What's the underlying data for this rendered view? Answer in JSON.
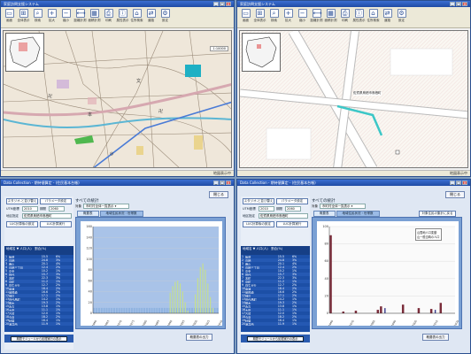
{
  "win1": {
    "title": "家庭訪問支援システム",
    "toolbar": [
      "画面",
      "全体表示",
      "検索",
      "拡大",
      "縮小",
      "距離計測",
      "面積計測",
      "印刷",
      "属性表示",
      "住所検索",
      "道路",
      "設定"
    ],
    "status": "地図表示中"
  },
  "win2": {
    "title": "家庭訪問支援システム",
    "toolbar": [
      "画面",
      "全体表示",
      "検索",
      "拡大",
      "縮小",
      "距離計測",
      "面積計測",
      "印刷",
      "属性表示",
      "住所検索",
      "道路",
      "設定"
    ],
    "map_label": "佐賀県鳥栖市鳥栖町",
    "status": "地図表示中"
  },
  "win3": {
    "title": "Data Collection - 期待値算定 - (住民基本台帳)",
    "close_label": "閉じる",
    "header": "すべての統計",
    "buttons": [
      "スタジオ-と並び替え",
      "パラメータ設定",
      "LUC計算後の設定",
      "LUC計算実行"
    ],
    "labels": [
      "UTM座標",
      "期間",
      "地区指定"
    ],
    "inputs": [
      "2010",
      "2060",
      "佐賀県鳥栖市鳥栖町"
    ],
    "select_label": "対象",
    "select_value": "市町村全体一覧表示",
    "tabs": [
      "概要表",
      "地域住民状況・世帯数"
    ],
    "list_header": "地域名 ▼ 人口(人)　割合(%)",
    "list": [
      [
        "1",
        "飯盛",
        "15.5",
        "6%"
      ],
      [
        "2",
        "鳥栖",
        "24.8",
        "3%"
      ],
      [
        "3",
        "鹿山",
        "20.1",
        "4%"
      ],
      [
        "4",
        "鳥栖三丁目",
        "12.4",
        "2%"
      ],
      [
        "5",
        "中央",
        "10.2",
        "1%"
      ],
      [
        "6",
        "田代",
        "15.7",
        "3%"
      ],
      [
        "7",
        "本町",
        "22.3",
        "3%"
      ],
      [
        "8",
        "京町",
        "11.2",
        "1%"
      ],
      [
        "9",
        "弥生が丘",
        "12.7",
        "2%"
      ],
      [
        "10",
        "幸津",
        "18.4",
        "2%"
      ],
      [
        "11",
        "曽根崎",
        "16.6",
        "2%"
      ],
      [
        "12",
        "神辺",
        "17.1",
        "2%"
      ],
      [
        "13",
        "田代昌町",
        "14.2",
        "1%"
      ],
      [
        "14",
        "藤木",
        "19.3",
        "2%"
      ],
      [
        "15",
        "永吉",
        "13.8",
        "1%"
      ],
      [
        "16",
        "大田",
        "11.1",
        "1%"
      ],
      [
        "17",
        "古賀",
        "12.0",
        "1%"
      ],
      [
        "18",
        "今泉",
        "18.2",
        "2%"
      ],
      [
        "19",
        "秋葉",
        "16.4",
        "1%"
      ],
      [
        "20",
        "酒井西",
        "11.9",
        "1%"
      ]
    ],
    "footer_button": "期間モジュールから処理実行の表示",
    "action_button": "概要表の出力",
    "chart_data": {
      "type": "bar",
      "title": "",
      "xlabel": "",
      "ylabel": "",
      "ylim": [
        0,
        160
      ],
      "yticks": [
        0,
        20,
        40,
        60,
        80,
        100,
        120,
        140,
        160
      ],
      "categories": [
        "1",
        "2",
        "3",
        "4",
        "5",
        "6",
        "7",
        "8",
        "9",
        "10",
        "11",
        "12",
        "13",
        "14",
        "15",
        "16",
        "17",
        "18",
        "19",
        "20",
        "21",
        "22",
        "23",
        "24",
        "25",
        "26",
        "27",
        "28",
        "29",
        "30",
        "31",
        "32",
        "33",
        "34",
        "35",
        "36",
        "37",
        "38",
        "39",
        "40",
        "41",
        "42",
        "43",
        "44",
        "45",
        "46",
        "47",
        "48",
        "49",
        "50"
      ],
      "xticklabels": [
        "1960",
        "1965",
        "1970",
        "1975",
        "1980",
        "1985",
        "1990",
        "1995",
        "2000",
        "2005",
        "2010"
      ],
      "series": [
        {
          "values": [
            10,
            10,
            10,
            10,
            10,
            10,
            10,
            10,
            10,
            10,
            10,
            10,
            10,
            10,
            10,
            10,
            10,
            10,
            10,
            10,
            10,
            10,
            10,
            10,
            10,
            10,
            10,
            10,
            10,
            10,
            10,
            10,
            10,
            10,
            10,
            10,
            10,
            10,
            10,
            10,
            10,
            10,
            10,
            10,
            10,
            10,
            10,
            10,
            10,
            10
          ]
        },
        {
          "values": [
            0,
            0,
            0,
            0,
            0,
            0,
            0,
            0,
            0,
            0,
            0,
            0,
            0,
            0,
            0,
            0,
            0,
            0,
            0,
            0,
            0,
            0,
            0,
            0,
            0,
            0,
            0,
            0,
            0,
            0,
            38,
            50,
            58,
            60,
            55,
            40,
            20,
            5,
            0,
            0,
            35,
            65,
            85,
            92,
            80,
            55,
            30,
            10,
            0,
            0
          ]
        }
      ]
    }
  },
  "win4": {
    "title": "Data Collection - 期待値算定 - (住民基本台帳)",
    "close_label": "閉じる",
    "header": "すべての統計",
    "buttons": [
      "スタジオ-と並び替え",
      "パラメータ設定",
      "LUC計算後の設定",
      "LUC計算実行"
    ],
    "labels": [
      "UTM座標",
      "期間",
      "地区指定"
    ],
    "inputs": [
      "2010",
      "2060",
      "佐賀県鳥栖市鳥栖町"
    ],
    "select_label": "対象",
    "select_value": "市町村全体一覧表示",
    "tabs": [
      "概要表",
      "地域住民状況・世帯数",
      "地域住民状況"
    ],
    "extra_button": "対象住民の集計に戻る",
    "list_header": "地域名 ▼ 人口(人)　割合(%)",
    "list": [
      [
        "1",
        "飯盛",
        "15.5",
        "6%"
      ],
      [
        "2",
        "鳥栖",
        "24.8",
        "3%"
      ],
      [
        "3",
        "鹿山",
        "20.1",
        "4%"
      ],
      [
        "4",
        "鳥栖三丁目",
        "12.4",
        "2%"
      ],
      [
        "5",
        "中央",
        "10.2",
        "1%"
      ],
      [
        "6",
        "田代",
        "15.7",
        "3%"
      ],
      [
        "7",
        "本町",
        "22.3",
        "3%"
      ],
      [
        "8",
        "京町",
        "11.2",
        "1%"
      ],
      [
        "9",
        "弥生が丘",
        "12.7",
        "2%"
      ],
      [
        "10",
        "幸津",
        "18.4",
        "2%"
      ],
      [
        "11",
        "曽根崎",
        "16.6",
        "2%"
      ],
      [
        "12",
        "神辺",
        "17.1",
        "2%"
      ],
      [
        "13",
        "田代昌町",
        "14.2",
        "1%"
      ],
      [
        "14",
        "藤木",
        "19.3",
        "2%"
      ],
      [
        "15",
        "永吉",
        "13.8",
        "1%"
      ],
      [
        "16",
        "大田",
        "11.1",
        "1%"
      ],
      [
        "17",
        "古賀",
        "12.0",
        "1%"
      ],
      [
        "18",
        "今泉",
        "18.2",
        "2%"
      ],
      [
        "19",
        "秋葉",
        "16.4",
        "1%"
      ],
      [
        "20",
        "酒井西",
        "11.9",
        "1%"
      ]
    ],
    "footer_button": "期間モジュールから処理実行の表示",
    "action_button": "概要表の出力",
    "legend": [
      "山間地人口変動",
      "山一般当時の人口"
    ],
    "chart_data": {
      "type": "bar",
      "title": "",
      "ylim": [
        0,
        100
      ],
      "yticks": [
        0,
        20,
        40,
        60,
        80,
        100
      ],
      "categories": [
        "1",
        "2",
        "3",
        "4",
        "5",
        "6",
        "7",
        "8",
        "9",
        "10",
        "11",
        "12",
        "13",
        "14",
        "15",
        "16",
        "17",
        "18",
        "19",
        "20",
        "21",
        "22",
        "23",
        "24",
        "25",
        "26",
        "27",
        "28",
        "29",
        "30",
        "31",
        "32",
        "33",
        "34",
        "35",
        "36",
        "37",
        "38",
        "39",
        "40"
      ],
      "xticklabels": [
        "1960",
        "1970",
        "1980",
        "1990",
        "2000",
        "2010",
        "2020"
      ],
      "series": [
        {
          "name": "山間地人口変動",
          "values": [
            90,
            0,
            0,
            0,
            2,
            0,
            0,
            0,
            3,
            0,
            0,
            0,
            0,
            0,
            0,
            4,
            8,
            0,
            0,
            0,
            0,
            0,
            0,
            10,
            0,
            0,
            0,
            0,
            6,
            0,
            0,
            0,
            5,
            0,
            0,
            12,
            0,
            0,
            0,
            0
          ]
        },
        {
          "name": "山一般当時の人口",
          "values": [
            0,
            0,
            0,
            0,
            0,
            0,
            0,
            0,
            0,
            0,
            0,
            0,
            0,
            0,
            0,
            0,
            0,
            6,
            0,
            0,
            0,
            0,
            0,
            0,
            0,
            0,
            0,
            0,
            0,
            0,
            0,
            0,
            0,
            4,
            0,
            0,
            0,
            0,
            0,
            0
          ]
        }
      ]
    }
  },
  "colors": {
    "titlebar": "#1f4ba4",
    "list_bg": "#1c4fa6",
    "chart_bg": "#7aa0d4"
  }
}
